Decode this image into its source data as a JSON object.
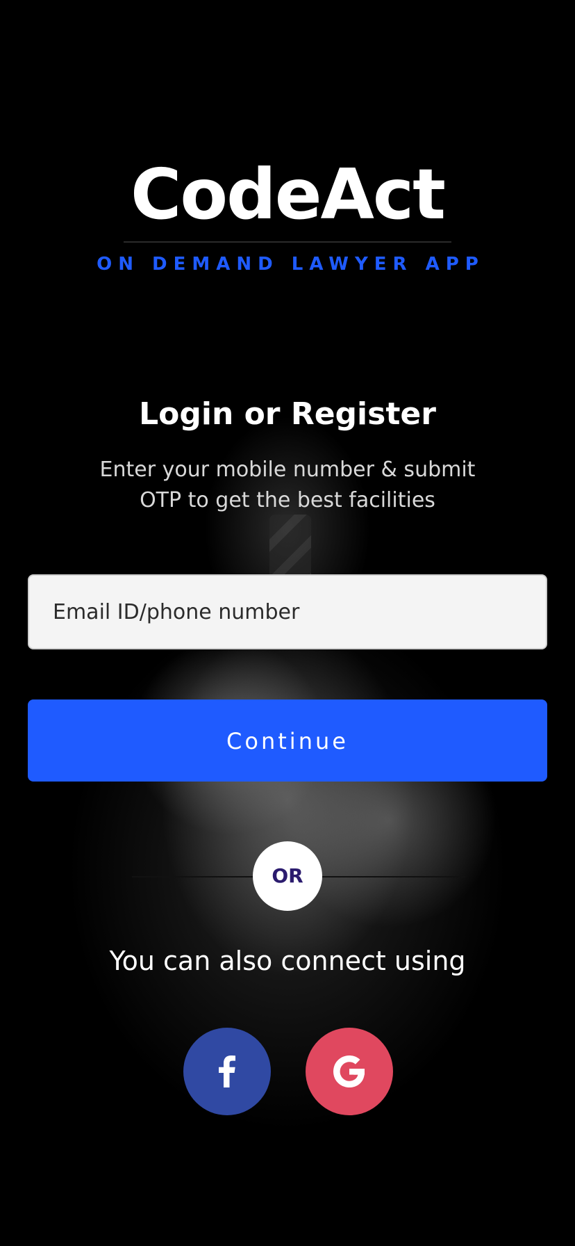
{
  "logo": {
    "title": "CodeAct",
    "tagline": "ON DEMAND LAWYER APP"
  },
  "login": {
    "heading": "Login or Register",
    "subtext": "Enter your mobile number & submit OTP to get the best facilities"
  },
  "input": {
    "placeholder": "Email ID/phone number",
    "value": ""
  },
  "continue_button": {
    "label": "Continue"
  },
  "divider": {
    "label": "OR"
  },
  "connect": {
    "text": "You can also connect using"
  },
  "social": {
    "facebook_icon": "facebook-icon",
    "google_icon": "google-icon"
  },
  "colors": {
    "primary": "#1f5bff",
    "facebook": "#3049a3",
    "google": "#e0485f",
    "background": "#000000"
  }
}
